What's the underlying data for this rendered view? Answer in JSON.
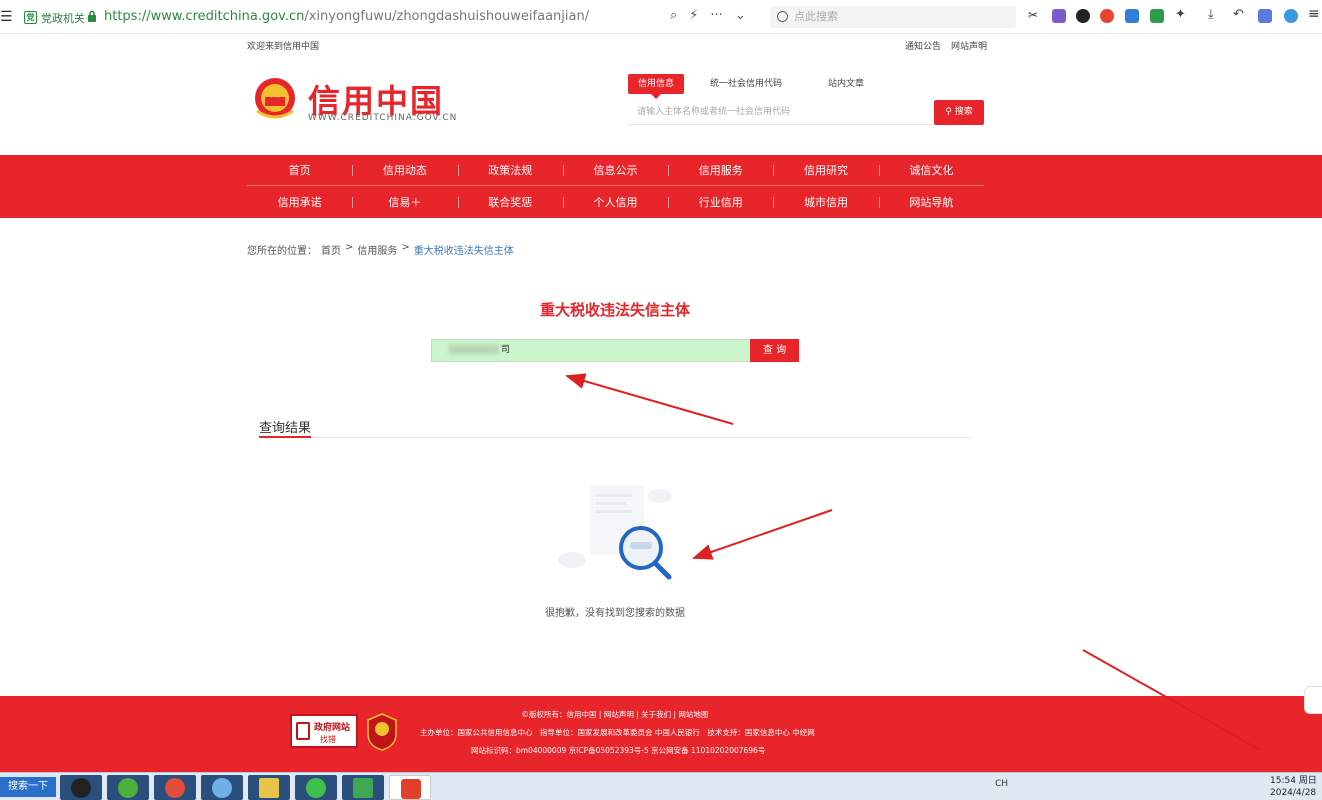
{
  "browser": {
    "site_badge": "党政机关",
    "url_host": "https://www.creditchina.gov.cn",
    "url_path": "/xinyongfuwu/zhongdashuishouweifaanjian/",
    "search_placeholder": "点此搜索"
  },
  "topstrip": {
    "welcome": "欢迎来到信用中国",
    "links": [
      "通知公告",
      "网站声明"
    ]
  },
  "header": {
    "logo_cn": "信用中国",
    "logo_en": "WWW.CREDITCHINA.GOV.CN",
    "search_tabs": [
      "信用信息",
      "统一社会信用代码",
      "站内文章"
    ],
    "search_placeholder": "请输入主体名称或者统一社会信用代码",
    "search_button": "搜索"
  },
  "nav": {
    "row1": [
      "首页",
      "信用动态",
      "政策法规",
      "信息公示",
      "信用服务",
      "信用研究",
      "诚信文化"
    ],
    "row2": [
      "信用承诺",
      "信易＋",
      "联合奖惩",
      "个人信用",
      "行业信用",
      "城市信用",
      "网站导航"
    ]
  },
  "breadcrumb": {
    "prefix": "您所在的位置：",
    "items": [
      "首页",
      "信用服务"
    ],
    "current": "重大税收违法失信主体",
    "sep": ">"
  },
  "main": {
    "title": "重大税收违法失信主体",
    "query_value": "司",
    "query_button": "查 询",
    "result_heading": "查询结果",
    "empty_message": "很抱歉，没有找到您搜索的数据"
  },
  "footer": {
    "badge_line1": "政府网站",
    "badge_line2": "找错",
    "line1": "©版权所有：信用中国 | 网站声明 | 关于我们 | 网站地图",
    "line2": "主办单位：国家公共信用信息中心　指导单位：国家发展和改革委员会 中国人民银行　技术支持：国家信息中心 中经网",
    "line3": "网站标识码：bm04000009 京ICP备05052393号-5 京公网安备 11010202007696号"
  },
  "taskbar": {
    "start_label": "搜索一下",
    "tray_lang": "CH",
    "time": "15:54 周日",
    "date": "2024/4/28"
  }
}
